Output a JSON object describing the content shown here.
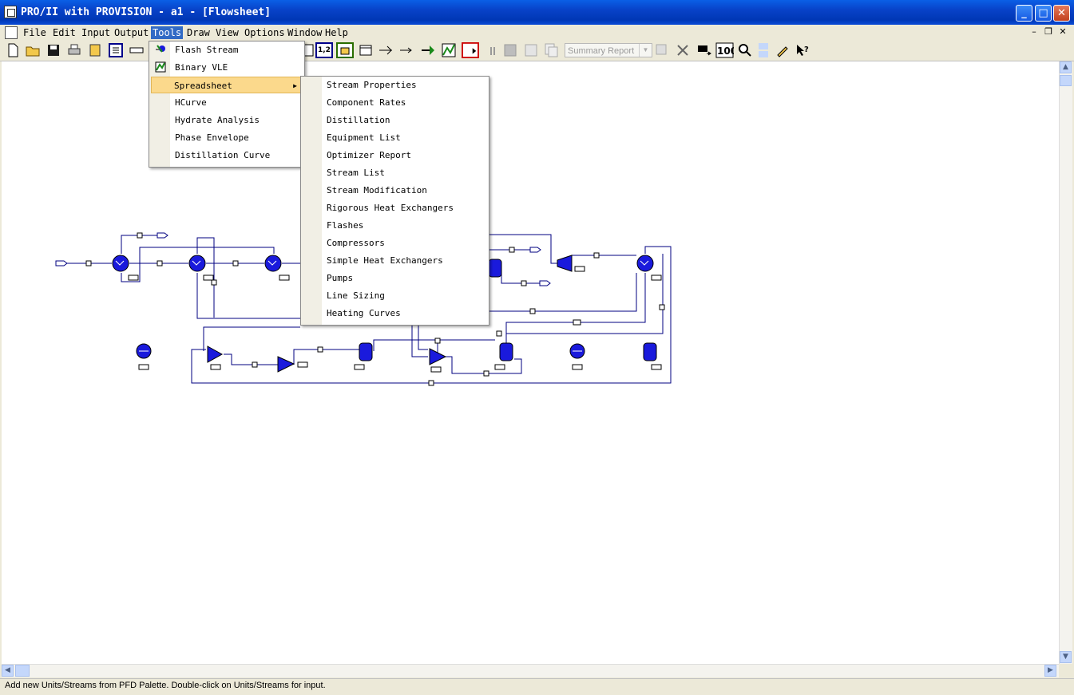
{
  "window": {
    "title": "PRO/II with PROVISION - a1 - [Flowsheet]"
  },
  "menubar": {
    "items": [
      "File",
      "Edit",
      "Input",
      "Output",
      "Tools",
      "Draw",
      "View",
      "Options",
      "Window",
      "Help"
    ]
  },
  "toolbar": {
    "summary_combo": "Summary Report"
  },
  "tools_menu": {
    "items": [
      "Flash Stream",
      "Binary VLE",
      "Spreadsheet",
      "HCurve",
      "Hydrate Analysis",
      "Phase Envelope",
      "Distillation Curve"
    ]
  },
  "spreadsheet_menu": {
    "items": [
      "Stream Properties",
      "Component Rates",
      "Distillation",
      "Equipment List",
      "Optimizer Report",
      "Stream List",
      "Stream Modification",
      "Rigorous Heat Exchangers",
      "Flashes",
      "Compressors",
      "Simple Heat Exchangers",
      "Pumps",
      "Line Sizing",
      "Heating Curves"
    ]
  },
  "statusbar": {
    "text": "Add new Units/Streams from PFD Palette.  Double-click on Units/Streams for input."
  },
  "colors": {
    "titlebar": "#0842c8",
    "highlight": "#fbd98c",
    "unit_fill": "#1a1adc",
    "stream_line": "#000080"
  }
}
